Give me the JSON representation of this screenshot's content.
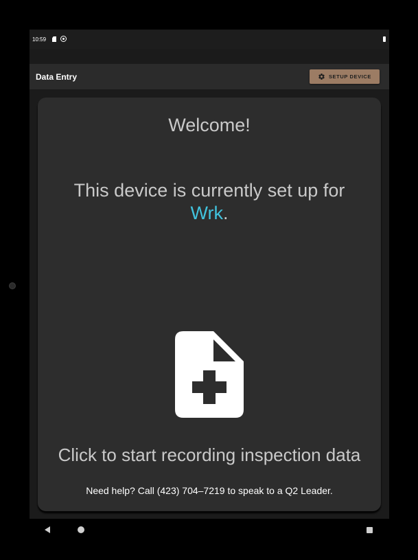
{
  "status_bar": {
    "time": "10:59",
    "icons": [
      "sd-card-icon",
      "sync-icon",
      "battery-icon"
    ]
  },
  "app_bar": {
    "title": "Data Entry",
    "setup_button_label": "SETUP DEVICE",
    "setup_button_icon": "gear-icon",
    "setup_button_color": "#9c7c64"
  },
  "main": {
    "welcome": "Welcome!",
    "setup_prefix": "This device is currently set up for",
    "org_name": "Wrk",
    "setup_suffix": ".",
    "new_record_icon": "note-add-icon",
    "start_prompt": "Click to start recording inspection data",
    "help_text": "Need help? Call (423) 704–7219 to speak to a Q2 Leader.",
    "accent_color": "#41c3de"
  },
  "nav_bar": {
    "buttons": [
      "back-icon",
      "home-icon",
      "recents-icon"
    ]
  }
}
